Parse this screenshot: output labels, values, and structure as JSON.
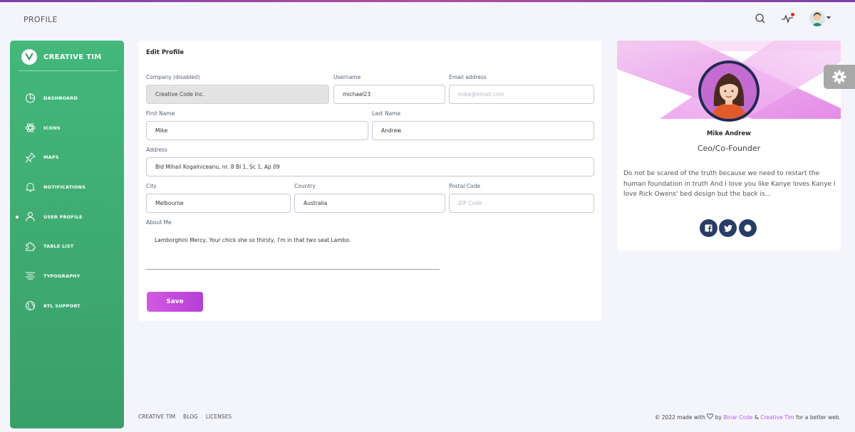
{
  "navbar": {
    "page_title": "PROFILE",
    "search_icon": "search-icon",
    "activity_icon": "activity-icon",
    "avatar_icon": "user-avatar-icon"
  },
  "sidebar": {
    "brand": "CREATIVE TIM",
    "items": [
      {
        "label": "DASHBOARD",
        "icon": "chart-pie-icon"
      },
      {
        "label": "ICONS",
        "icon": "atom-icon"
      },
      {
        "label": "MAPS",
        "icon": "pin-icon"
      },
      {
        "label": "NOTIFICATIONS",
        "icon": "bell-icon"
      },
      {
        "label": "USER PROFILE",
        "icon": "user-icon",
        "active": true
      },
      {
        "label": "TABLE LIST",
        "icon": "puzzle-icon"
      },
      {
        "label": "TYPOGRAPHY",
        "icon": "align-center-icon"
      },
      {
        "label": "RTL SUPPORT",
        "icon": "world-icon"
      }
    ]
  },
  "edit_profile": {
    "title": "Edit Profile",
    "company": {
      "label": "Company (disabled)",
      "value": "Creative Code Inc."
    },
    "username": {
      "label": "Username",
      "value": "michael23"
    },
    "email": {
      "label": "Email address",
      "placeholder": "mike@email.com"
    },
    "first_name": {
      "label": "First Name",
      "value": "Mike"
    },
    "last_name": {
      "label": "Last Name",
      "value": "Andrew"
    },
    "address": {
      "label": "Address",
      "value": "Bld Mihail Kogalniceanu, nr. 8 Bl 1, Sc 1, Ap 09"
    },
    "city": {
      "label": "City",
      "value": "Melbourne"
    },
    "country": {
      "label": "Country",
      "value": "Australia"
    },
    "postal_code": {
      "label": "Postal Code",
      "placeholder": "ZIP Code"
    },
    "about": {
      "label": "About Me",
      "value": "Lamborghini Mercy, Your chick she so thirsty, I'm in that two seat Lambo."
    },
    "save_label": "Save"
  },
  "profile_card": {
    "name": "Mike Andrew",
    "role": "Ceo/Co-Founder",
    "description": "Do not be scared of the truth because we need to restart the human foundation in truth And I love you like Kanye loves Kanye I love Rick Owens' bed design but the back is...",
    "social": [
      "facebook-icon",
      "twitter-icon",
      "dribbble-icon"
    ]
  },
  "footer": {
    "links": [
      "CREATIVE TIM",
      "BLOG",
      "LICENSES"
    ],
    "credit_prefix": "© 2022 made with",
    "credit_by": "by",
    "credit_brand1": "Binar Code",
    "credit_amp": "&",
    "credit_brand2": "Creative Tim",
    "credit_suffix": "for a better web."
  },
  "colors": {
    "sidebar": "#43b87a",
    "accent": "#c04fd8",
    "social": "#283d64"
  }
}
